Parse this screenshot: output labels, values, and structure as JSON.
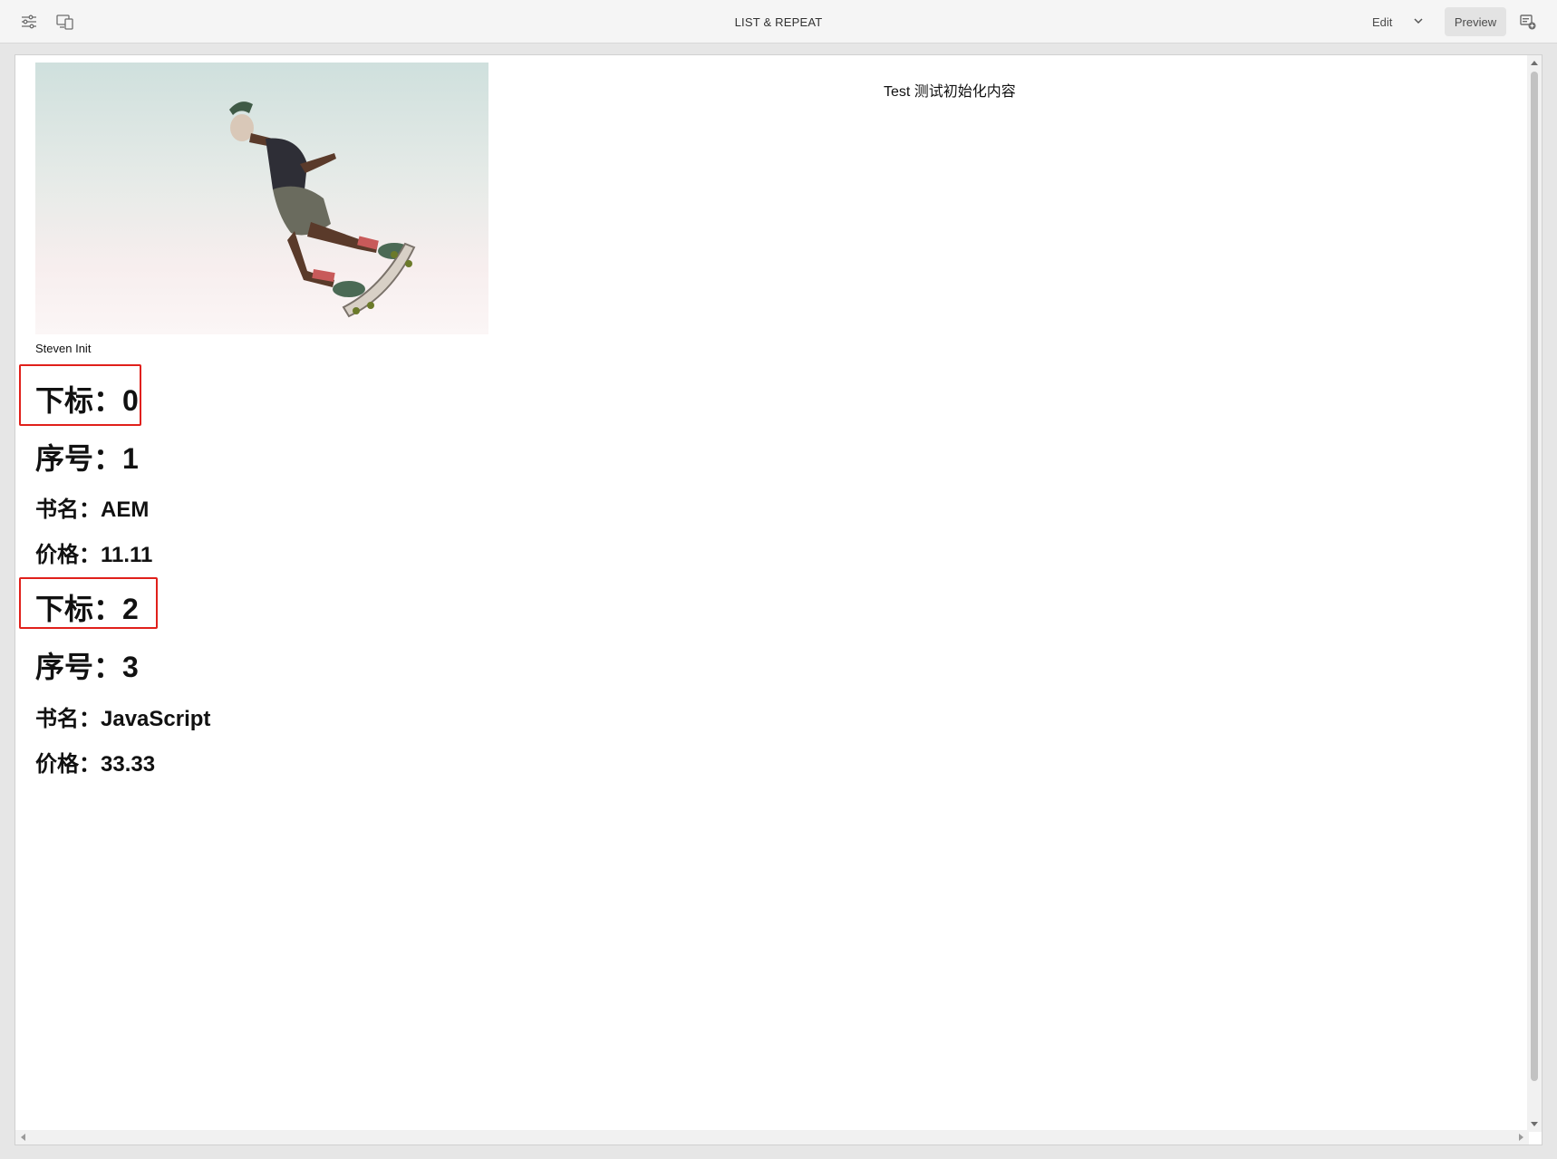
{
  "toolbar": {
    "title": "LIST & REPEAT",
    "mode_label": "Edit",
    "preview_label": "Preview",
    "icons": [
      "sliders-icon",
      "device-preview-icon",
      "chevron-down-icon",
      "annotation-add-icon"
    ]
  },
  "content": {
    "top_text": "Test 测试初始化内容",
    "caption": "Steven Init",
    "items": [
      {
        "index_text": "下标：0",
        "number_text": "序号：1",
        "name_text": "书名：AEM",
        "price_text": "价格：11.11"
      },
      {
        "index_text": "下标：2",
        "number_text": "序号：3",
        "name_text": "书名：JavaScript",
        "price_text": "价格：33.33"
      }
    ]
  },
  "colors": {
    "highlight": "#e0201b",
    "toolbar_bg": "#f5f5f5"
  }
}
